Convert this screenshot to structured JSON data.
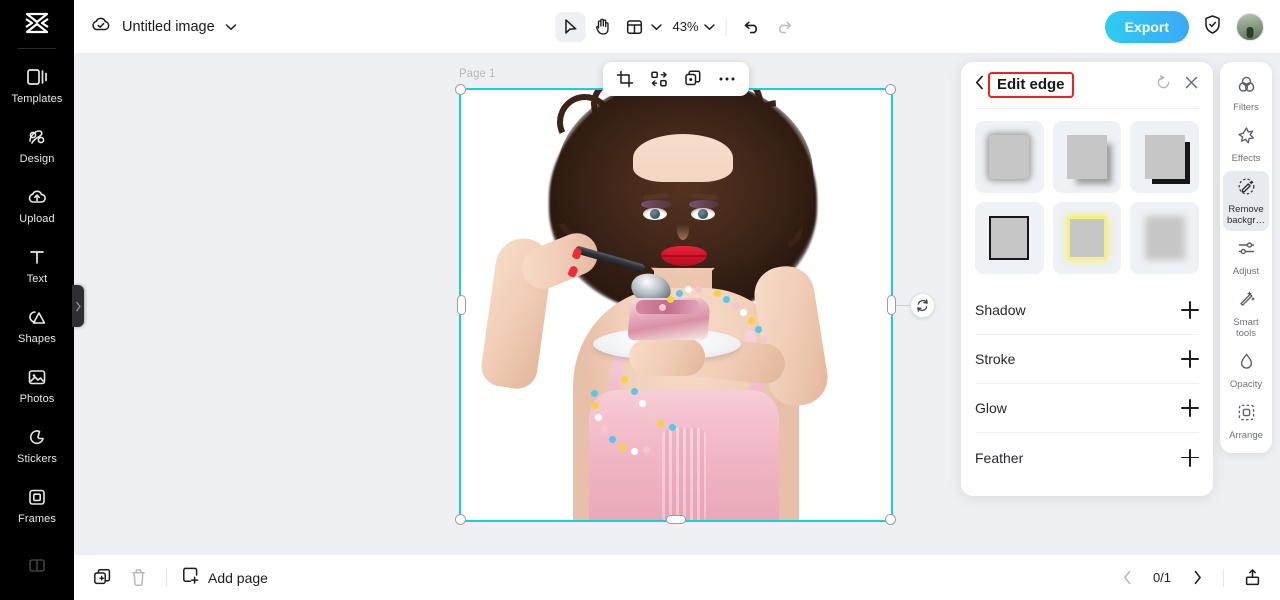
{
  "app": {
    "logo_icon": "capcut-logo-icon"
  },
  "sidebar": {
    "items": [
      {
        "label": "Templates",
        "icon": "templates-icon"
      },
      {
        "label": "Design",
        "icon": "design-icon"
      },
      {
        "label": "Upload",
        "icon": "upload-cloud-icon"
      },
      {
        "label": "Text",
        "icon": "text-icon"
      },
      {
        "label": "Shapes",
        "icon": "shapes-icon"
      },
      {
        "label": "Photos",
        "icon": "photos-icon"
      },
      {
        "label": "Stickers",
        "icon": "stickers-icon"
      },
      {
        "label": "Frames",
        "icon": "frames-icon"
      }
    ],
    "collapse_icon": "chevron-right-icon"
  },
  "topbar": {
    "cloud_icon": "cloud-saved-icon",
    "doc_title": "Untitled image",
    "doc_chevron_icon": "chevron-down-icon",
    "tools": [
      {
        "name": "select-tool",
        "icon": "cursor-arrow-icon",
        "active": true
      },
      {
        "name": "hand-tool",
        "icon": "hand-icon",
        "active": false
      }
    ],
    "layout_icon": "layout-grid-icon",
    "layout_chevron_icon": "chevron-down-icon",
    "zoom_level": "43%",
    "zoom_chevron_icon": "chevron-down-icon",
    "undo_icon": "undo-icon",
    "redo_icon": "redo-icon",
    "export_label": "Export",
    "shield_icon": "shield-check-icon",
    "avatar_icon": "user-avatar"
  },
  "canvas": {
    "page_label": "Page 1",
    "float_toolbar": [
      {
        "name": "crop-button",
        "icon": "crop-icon"
      },
      {
        "name": "replace-button",
        "icon": "replace-swap-icon"
      },
      {
        "name": "duplicate-button",
        "icon": "duplicate-icon"
      },
      {
        "name": "more-options-button",
        "icon": "ellipsis-icon"
      }
    ],
    "rotate_icon": "rotate-icon"
  },
  "right_panel": {
    "back_icon": "chevron-left-icon",
    "title": "Edit edge",
    "reset_icon": "reset-icon",
    "close_icon": "close-icon",
    "presets": [
      {
        "name": "preset-soft-shadow",
        "style": "p1"
      },
      {
        "name": "preset-drop-shadow",
        "style": "p2"
      },
      {
        "name": "preset-hard-shadow",
        "style": "p3"
      },
      {
        "name": "preset-stroke-black",
        "style": "p4"
      },
      {
        "name": "preset-glow-yellow",
        "style": "p5"
      },
      {
        "name": "preset-feather-blur",
        "style": "p6"
      }
    ],
    "options": [
      {
        "label": "Shadow",
        "action_icon": "plus-icon"
      },
      {
        "label": "Stroke",
        "action_icon": "plus-icon"
      },
      {
        "label": "Glow",
        "action_icon": "plus-icon"
      },
      {
        "label": "Feather",
        "action_icon": "plus-icon"
      }
    ]
  },
  "right_rail": {
    "items": [
      {
        "label": "Filters",
        "icon": "filters-icon",
        "selected": false
      },
      {
        "label": "Effects",
        "icon": "effects-icon",
        "selected": false
      },
      {
        "label": "Remove backgr…",
        "icon": "remove-background-icon",
        "selected": true
      },
      {
        "label": "Adjust",
        "icon": "adjust-sliders-icon",
        "selected": false
      },
      {
        "label": "Smart tools",
        "icon": "smart-tools-icon",
        "selected": false
      },
      {
        "label": "Opacity",
        "icon": "opacity-drop-icon",
        "selected": false
      },
      {
        "label": "Arrange",
        "icon": "arrange-icon",
        "selected": false
      }
    ]
  },
  "bottombar": {
    "duplicate_page_icon": "duplicate-page-icon",
    "delete_page_icon": "trash-icon",
    "add_page_icon": "add-page-icon",
    "add_page_label": "Add page",
    "prev_page_icon": "chevron-left-icon",
    "page_indicator": "0/1",
    "next_page_icon": "chevron-right-icon",
    "export_tray_icon": "export-tray-icon"
  },
  "colors": {
    "accent": "#17cfe0",
    "export_gradient_start": "#2ecdf0",
    "export_gradient_end": "#3aa9f5",
    "highlight_outline": "#f21f1f",
    "sidebar_bg": "#000000"
  }
}
